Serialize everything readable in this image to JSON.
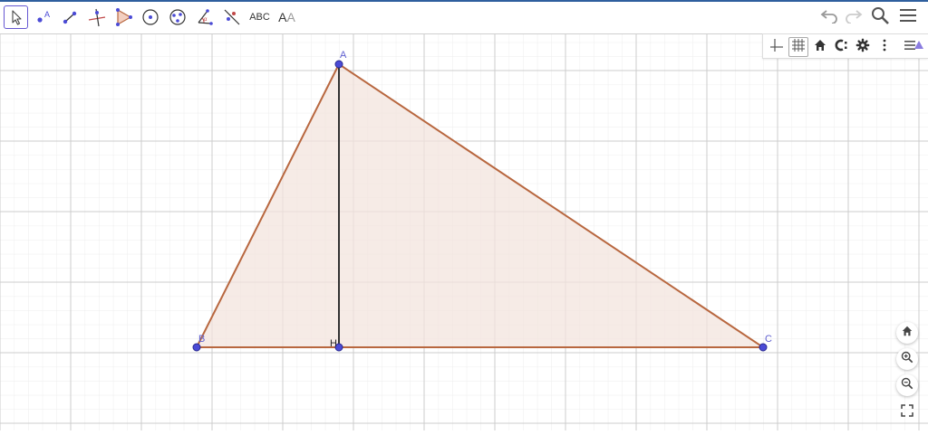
{
  "toolbar": {
    "tools": [
      {
        "name": "move-tool-icon"
      },
      {
        "name": "point-tool-icon",
        "label": "A"
      },
      {
        "name": "segment-tool-icon"
      },
      {
        "name": "perpendicular-line-tool-icon"
      },
      {
        "name": "polygon-tool-icon"
      },
      {
        "name": "circle-center-point-tool-icon"
      },
      {
        "name": "circle-three-points-tool-icon"
      },
      {
        "name": "angle-tool-icon"
      },
      {
        "name": "reflect-tool-icon"
      },
      {
        "name": "text-tool",
        "label": "ABC"
      },
      {
        "name": "style-text-tool",
        "label": "AA"
      }
    ],
    "right_buttons": [
      "undo-icon",
      "redo-icon",
      "search-icon",
      "menu-icon"
    ]
  },
  "style_bar": {
    "buttons": [
      "axes-toggle-icon",
      "grid-toggle-icon",
      "home-icon",
      "point-capturing-icon",
      "gear-icon",
      "more-icon",
      "style-bar-toggle-icon"
    ]
  },
  "graphics": {
    "points": [
      {
        "name": "A",
        "label": "A"
      },
      {
        "name": "B",
        "label": "B"
      },
      {
        "name": "C",
        "label": "C"
      },
      {
        "name": "H",
        "label": "H"
      }
    ],
    "colors": {
      "polygon_fill": "#f3e4de",
      "polygon_stroke": "#b8673f",
      "point_fill": "#4b4bd6",
      "altitude": "#333333",
      "grid_minor": "#ececec",
      "grid_major": "#cccccc"
    }
  },
  "zoom_controls": [
    "home-view-icon",
    "zoom-in-icon",
    "zoom-out-icon",
    "fullscreen-icon"
  ]
}
